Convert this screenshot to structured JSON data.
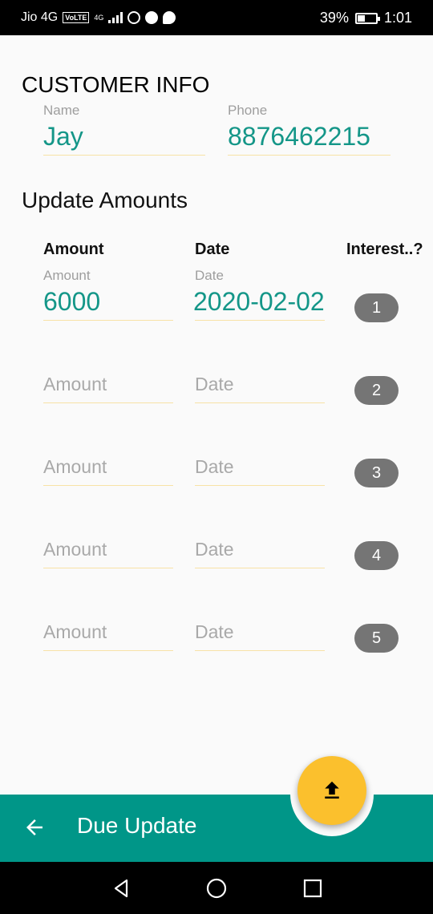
{
  "status_bar": {
    "carrier": "Jio 4G",
    "volte": "VoLTE",
    "net": "4G",
    "battery": "39%",
    "time": "1:01"
  },
  "customer": {
    "title": "CUSTOMER INFO",
    "name_label": "Name",
    "name_value": "Jay",
    "phone_label": "Phone",
    "phone_value": "8876462215"
  },
  "update": {
    "title": "Update Amounts",
    "headers": {
      "amount": "Amount",
      "date": "Date",
      "interest": "Interest..?"
    },
    "rows": [
      {
        "amount_label": "Amount",
        "amount": "6000",
        "date_label": "Date",
        "date": "2020-02-02",
        "index": "1"
      },
      {
        "amount_placeholder": "Amount",
        "date_placeholder": "Date",
        "index": "2"
      },
      {
        "amount_placeholder": "Amount",
        "date_placeholder": "Date",
        "index": "3"
      },
      {
        "amount_placeholder": "Amount",
        "date_placeholder": "Date",
        "index": "4"
      },
      {
        "amount_placeholder": "Amount",
        "date_placeholder": "Date",
        "index": "5"
      }
    ]
  },
  "bottom_bar": {
    "title": "Due Update",
    "fab_icon": "upload-icon",
    "back_icon": "arrow-back-icon"
  },
  "colors": {
    "primary": "#009688",
    "accent": "#fbc02d",
    "value_text": "#149688",
    "chip": "#757575"
  }
}
